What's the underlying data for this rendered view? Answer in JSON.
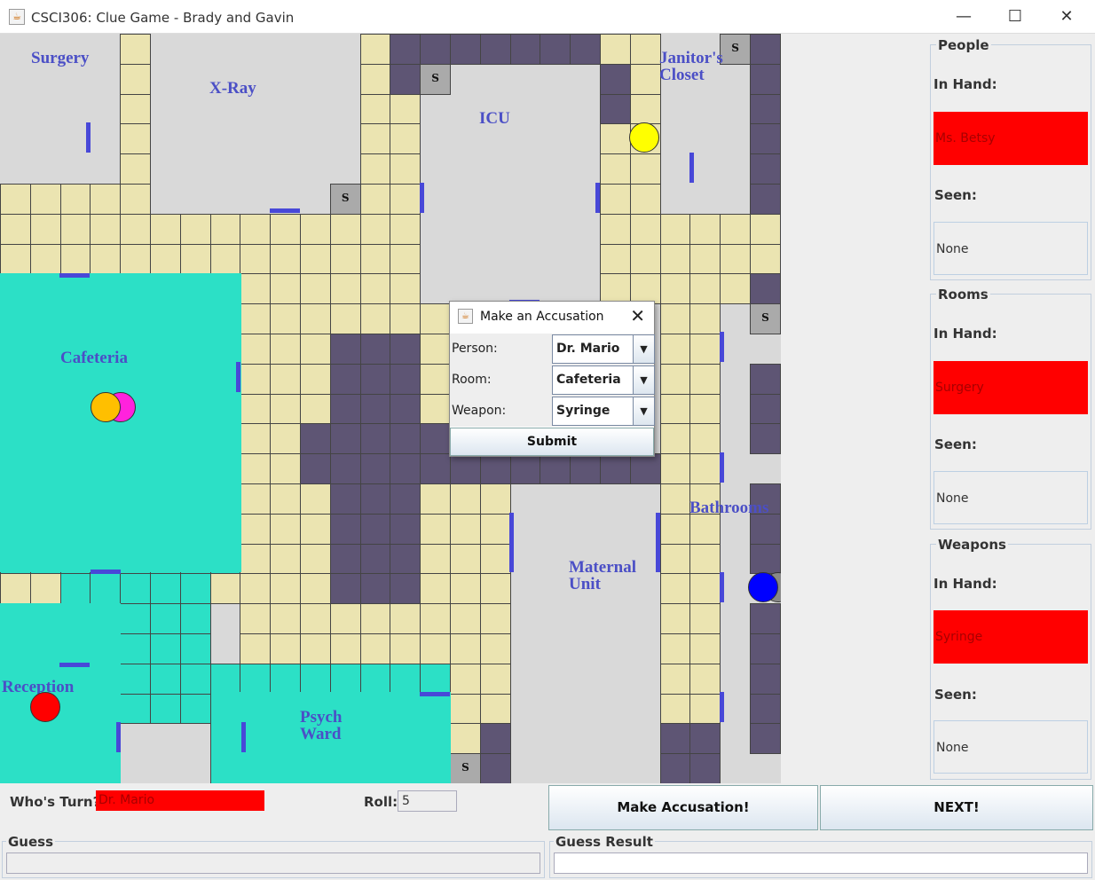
{
  "window": {
    "title": "CSCI306: Clue Game - Brady and Gavin",
    "minimize": "—",
    "maximize": "☐",
    "close": "✕"
  },
  "rooms": {
    "surgery": "Surgery",
    "xray": "X-Ray",
    "icu": "ICU",
    "janitor": "Janitor's\nCloset",
    "cafeteria": "Cafeteria",
    "bathrooms": "Bathrooms",
    "maternal": "Maternal\nUnit",
    "reception": "Reception",
    "psych": "Psych\nWard"
  },
  "secret_passage_mark": "S",
  "colors": {
    "walkway": "#ebe4b1",
    "unused": "#5e5574",
    "room": "#d9d9d9",
    "room_alt": "#2ce0c6",
    "door": "#4848d8",
    "card": "#ff0000"
  },
  "tokens": [
    {
      "color": "#ffff00"
    },
    {
      "color": "#ff22dd"
    },
    {
      "color": "#ffbf00"
    },
    {
      "color": "#888888"
    },
    {
      "color": "#0000ff"
    },
    {
      "color": "#ff0000"
    }
  ],
  "side": {
    "people": {
      "title": "People",
      "in_hand_label": "In Hand:",
      "in_hand": "Ms. Betsy",
      "seen_label": "Seen:",
      "seen": "None"
    },
    "rooms": {
      "title": "Rooms",
      "in_hand_label": "In Hand:",
      "in_hand": "Surgery",
      "seen_label": "Seen:",
      "seen": "None"
    },
    "weapons": {
      "title": "Weapons",
      "in_hand_label": "In Hand:",
      "in_hand": "Syringe",
      "seen_label": "Seen:",
      "seen": "None"
    }
  },
  "bottom": {
    "turn_label": "Who's Turn?",
    "turn_value": "Dr. Mario",
    "roll_label": "Roll:",
    "roll_value": "5",
    "accuse_button": "Make Accusation!",
    "next_button": "NEXT!",
    "guess_title": "Guess",
    "guess_value": "",
    "result_title": "Guess Result",
    "result_value": ""
  },
  "dialog": {
    "title": "Make an Accusation",
    "close": "✕",
    "person_label": "Person:",
    "person_value": "Dr. Mario",
    "room_label": "Room:",
    "room_value": "Cafeteria",
    "weapon_label": "Weapon:",
    "weapon_value": "Syringe",
    "dropdown_arrow": "▼",
    "submit": "Submit"
  }
}
